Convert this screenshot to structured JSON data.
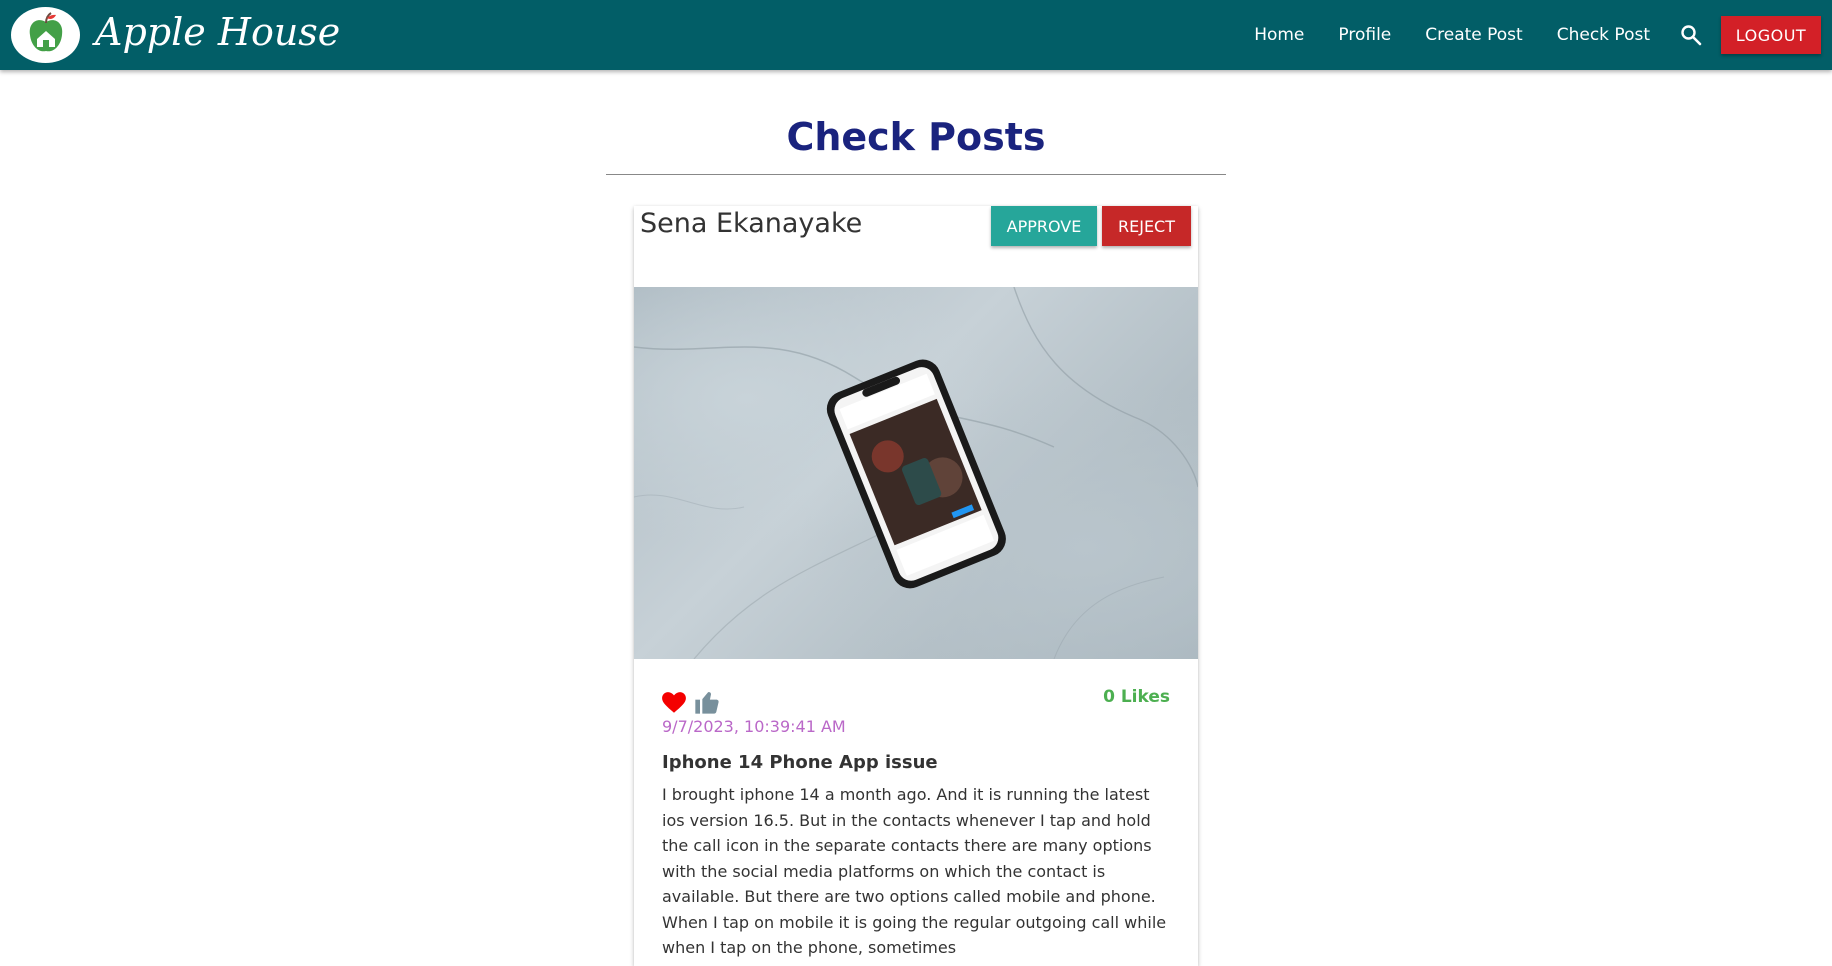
{
  "navbar": {
    "brand": "Apple House",
    "links": [
      "Home",
      "Profile",
      "Create Post",
      "Check Post"
    ],
    "logout_label": "LOGOUT",
    "bg_color": "#025e67"
  },
  "page": {
    "title": "Check Posts"
  },
  "post": {
    "author": "Sena Ekanayake",
    "approve_label": "APPROVE",
    "reject_label": "REJECT",
    "likes_label": "0 Likes",
    "timestamp": "9/7/2023, 10:39:41 AM",
    "title": "Iphone 14 Phone App issue",
    "body": "I brought iphone 14 a month ago. And it is running the latest ios version 16.5. But in the contacts whenever I tap and hold the call icon in the separate contacts there are many options with the social media platforms on which the contact is available. But there are two options called mobile and phone. When I tap on mobile it is going the regular outgoing call while when I tap on the phone, sometimes"
  },
  "colors": {
    "approve": "#26a69a",
    "reject": "#c62828",
    "likes": "#4caf50",
    "timestamp": "#ba68c8",
    "title": "#1a237e"
  },
  "icons": {
    "logo": "apple-house-logo-icon",
    "search": "search-icon",
    "heart": "heart-icon",
    "thumb": "thumbs-up-icon"
  }
}
